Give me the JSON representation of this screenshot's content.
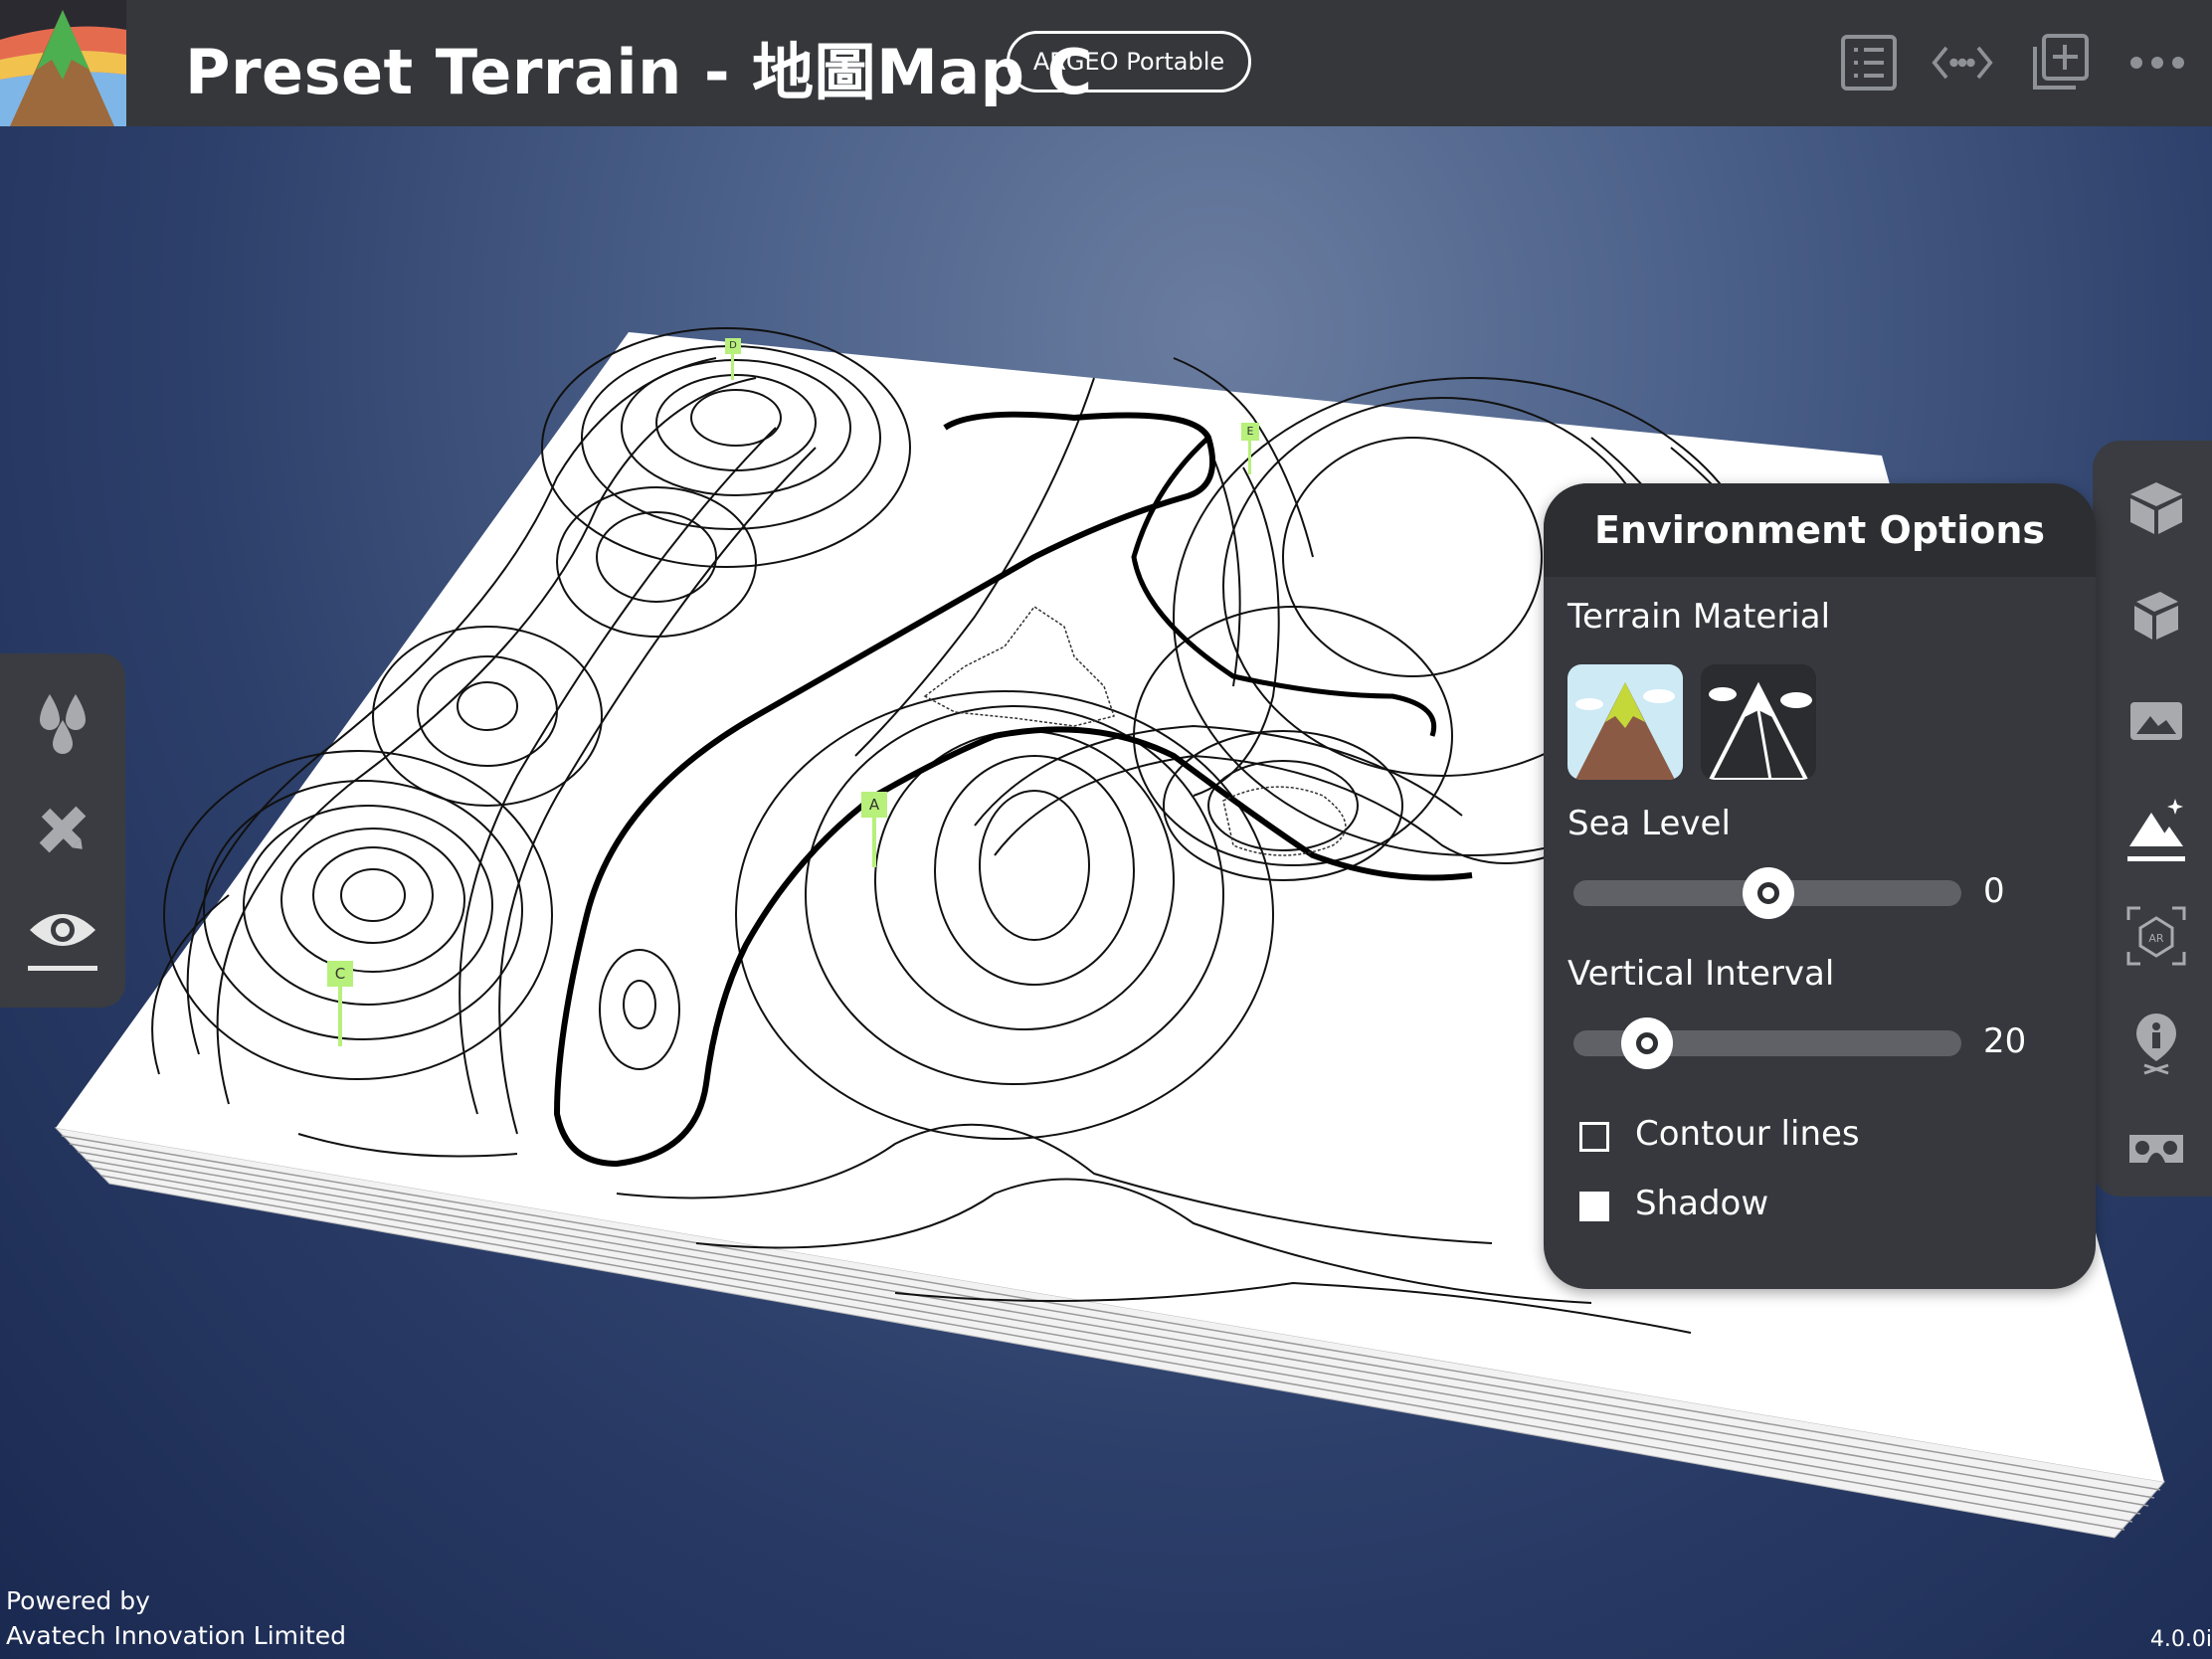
{
  "header": {
    "title": "Preset Terrain - 地圖Map C",
    "badge": "ARGEO Portable",
    "icons": [
      "list-icon",
      "code-icon",
      "add-layer-icon",
      "more-icon"
    ]
  },
  "left_toolbar": {
    "items": [
      "water-drop-icon",
      "ruler-pencil-icon",
      "eye-icon"
    ],
    "active": "eye-icon"
  },
  "right_toolbar": {
    "items": [
      "box-top-icon",
      "box-side-icon",
      "landscape-image-icon",
      "terrain-sparkle-icon",
      "ar-icon",
      "person-pin-icon",
      "vr-headset-icon"
    ],
    "active": "terrain-sparkle-icon"
  },
  "markers": [
    "D",
    "E",
    "A",
    "C"
  ],
  "env_panel": {
    "title": "Environment Options",
    "terrain_material_label": "Terrain Material",
    "sea_level_label": "Sea Level",
    "sea_level_value": "0",
    "sea_level_fraction": 0.5,
    "vertical_interval_label": "Vertical Interval",
    "vertical_interval_value": "20",
    "vertical_interval_fraction": 0.19,
    "contour_lines_label": "Contour lines",
    "contour_lines_checked": false,
    "shadow_label": "Shadow",
    "shadow_checked": true
  },
  "footer": {
    "powered_by": "Powered by",
    "company": "Avatech Innovation Limited",
    "version": "4.0.0i"
  },
  "colors": {
    "topbar": "#35373b",
    "panel": "#36383d",
    "marker": "#b7f07a"
  }
}
